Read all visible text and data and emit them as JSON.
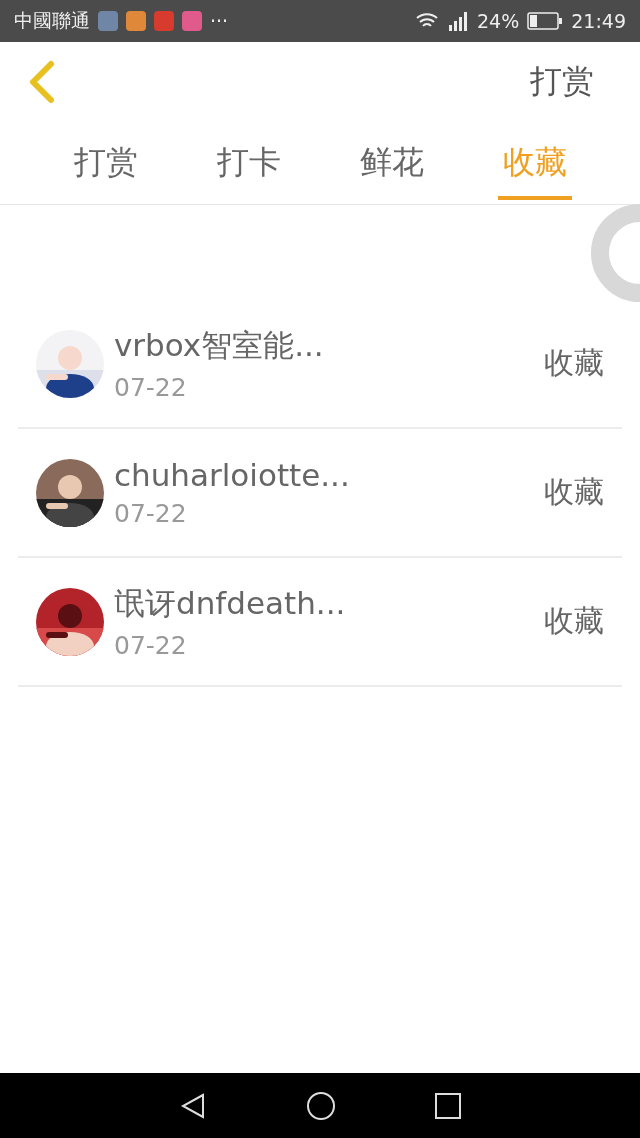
{
  "status_bar": {
    "carrier": "中國聯通",
    "more": "···",
    "battery": "24%",
    "time": "21:49"
  },
  "header": {
    "title": "打赏"
  },
  "tabs": [
    {
      "label": "打赏",
      "selected": false
    },
    {
      "label": "打卡",
      "selected": false
    },
    {
      "label": "鲜花",
      "selected": false
    },
    {
      "label": "收藏",
      "selected": true
    }
  ],
  "items": [
    {
      "name": "vrbox智室能...",
      "date": "07-22",
      "action": "收藏"
    },
    {
      "name": "chuharloiotte...",
      "date": "07-22",
      "action": "收藏"
    },
    {
      "name": "氓讶dnfdeath...",
      "date": "07-22",
      "action": "收藏"
    }
  ]
}
